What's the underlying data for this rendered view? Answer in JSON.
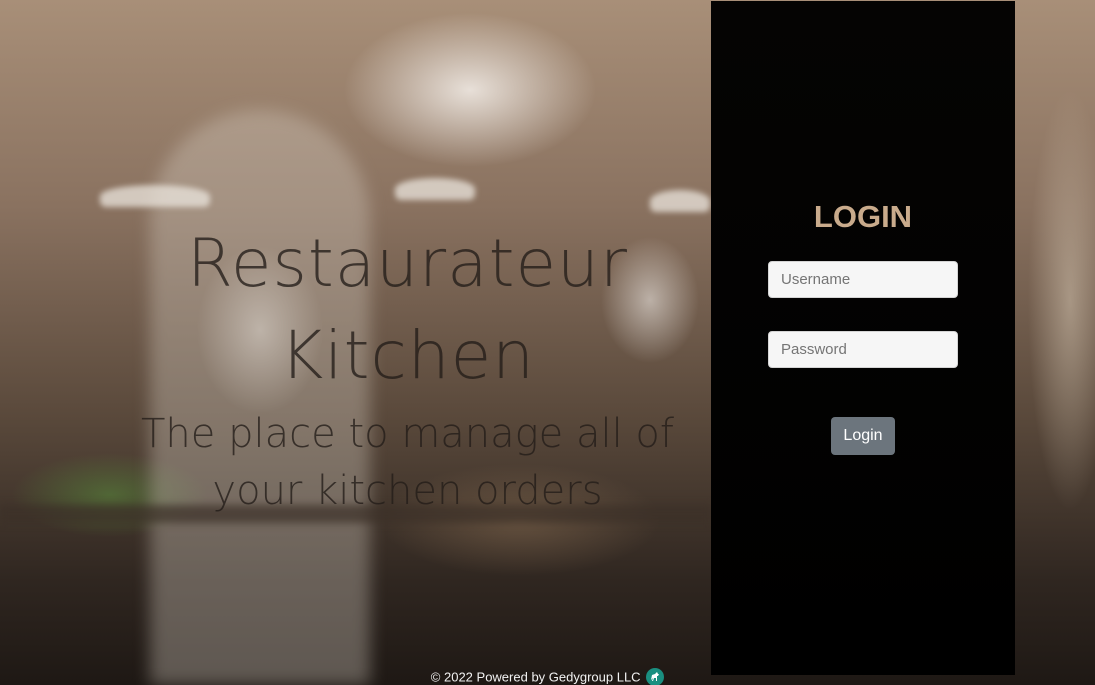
{
  "hero": {
    "title_line1": "Restaurateur",
    "title_line2": "Kitchen",
    "subtitle_line1": "The place to manage all of",
    "subtitle_line2": "your kitchen orders"
  },
  "login": {
    "heading": "LOGIN",
    "username_placeholder": "Username",
    "password_placeholder": "Password",
    "button_label": "Login"
  },
  "footer": {
    "text": "© 2022 Powered by Gedygroup LLC",
    "brand_icon": "gedygroup-logo-icon"
  },
  "colors": {
    "heading_accent": "#c9ab8c",
    "panel_background": "#000000",
    "button_background": "#6c757d",
    "brand_icon_color": "#1a8f80"
  }
}
